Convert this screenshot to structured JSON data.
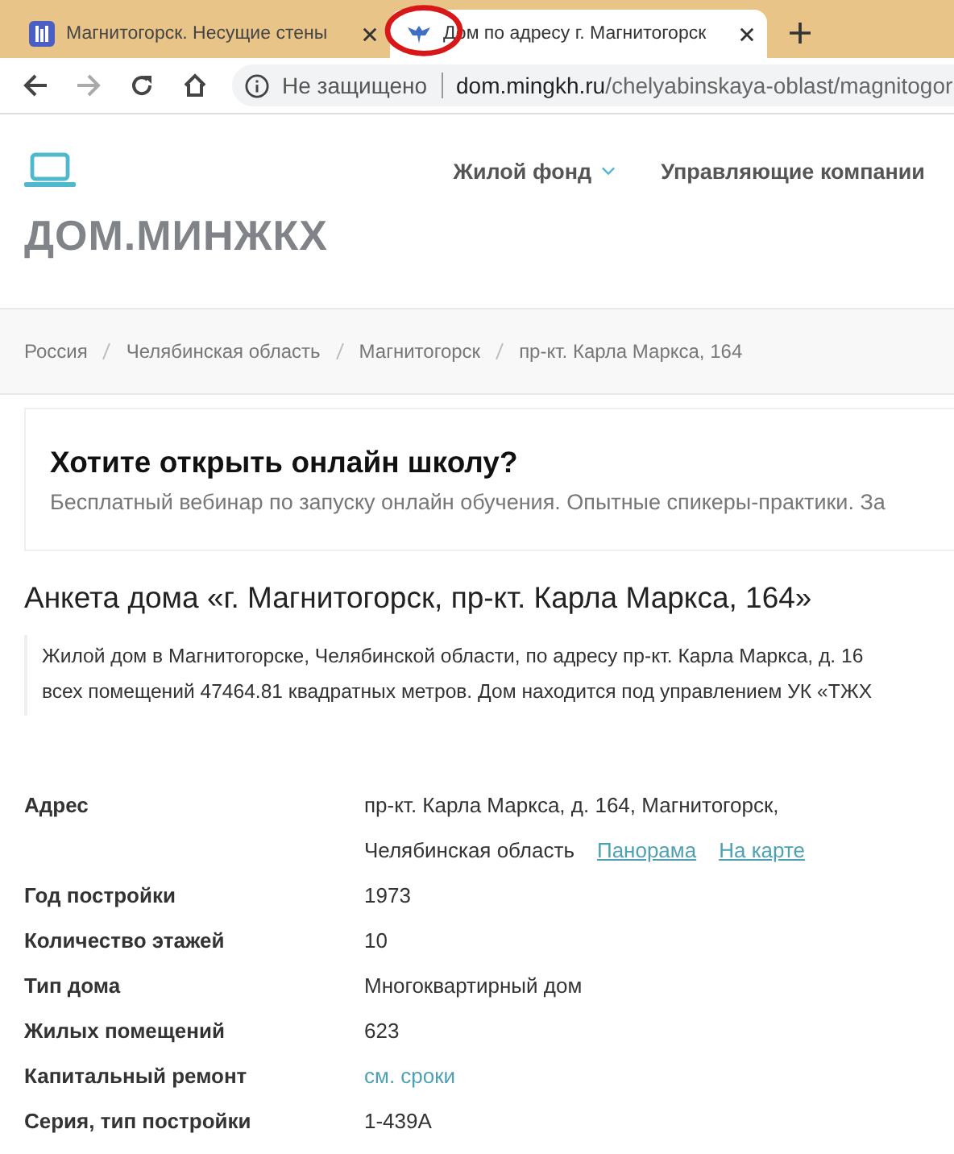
{
  "browser": {
    "tabs": [
      {
        "title": "Магнитогорск. Несущие стены",
        "selected": false
      },
      {
        "title": "Дом по адресу г. Магнитогорск",
        "selected": true
      }
    ],
    "security": "Не защищено",
    "url_host": "dom.mingkh.ru",
    "url_path": "/chelyabinskaya-oblast/magnitogor"
  },
  "header": {
    "nav": [
      {
        "label": "Жилой фонд",
        "dropdown": true
      },
      {
        "label": "Управляющие компании",
        "dropdown": false
      }
    ],
    "brand": "ДОМ.МИНЖКХ"
  },
  "breadcrumbs": [
    "Россия",
    "Челябинская область",
    "Магнитогорск",
    "пр-кт. Карла Маркса, 164"
  ],
  "ad": {
    "title": "Хотите открыть онлайн школу?",
    "text": "Бесплатный вебинар по запуску онлайн обучения. Опытные спикеры-практики. За"
  },
  "heading": "Анкета дома «г. Магнитогорск, пр-кт. Карла Маркса, 164»",
  "description": [
    "Жилой дом в Магнитогорске, Челябинской области, по адресу пр-кт. Карла Маркса, д. 16",
    "всех помещений 47464.81 квадратных метров. Дом находится под управлением УК «ТЖХ"
  ],
  "details": [
    {
      "label": "Адрес",
      "lines": [
        [
          {
            "kind": "text",
            "text": "пр-кт. Карла Маркса, д. 164, Магнитогорск,"
          }
        ],
        [
          {
            "kind": "text",
            "text": "Челябинская область"
          },
          {
            "kind": "link",
            "text": "Панорама",
            "underline": true
          },
          {
            "kind": "link",
            "text": "На карте",
            "underline": true
          }
        ]
      ]
    },
    {
      "label": "Год постройки",
      "lines": [
        [
          {
            "kind": "text",
            "text": "1973"
          }
        ]
      ]
    },
    {
      "label": "Количество этажей",
      "lines": [
        [
          {
            "kind": "text",
            "text": "10"
          }
        ]
      ]
    },
    {
      "label": "Тип дома",
      "lines": [
        [
          {
            "kind": "text",
            "text": "Многоквартирный дом"
          }
        ]
      ]
    },
    {
      "label": "Жилых помещений",
      "lines": [
        [
          {
            "kind": "text",
            "text": "623"
          }
        ]
      ]
    },
    {
      "label": "Капитальный ремонт",
      "lines": [
        [
          {
            "kind": "link",
            "text": "см. сроки",
            "underline": false
          }
        ]
      ]
    },
    {
      "label": "Серия, тип постройки",
      "lines": [
        [
          {
            "kind": "text",
            "text": "1-439А"
          }
        ]
      ]
    }
  ]
}
